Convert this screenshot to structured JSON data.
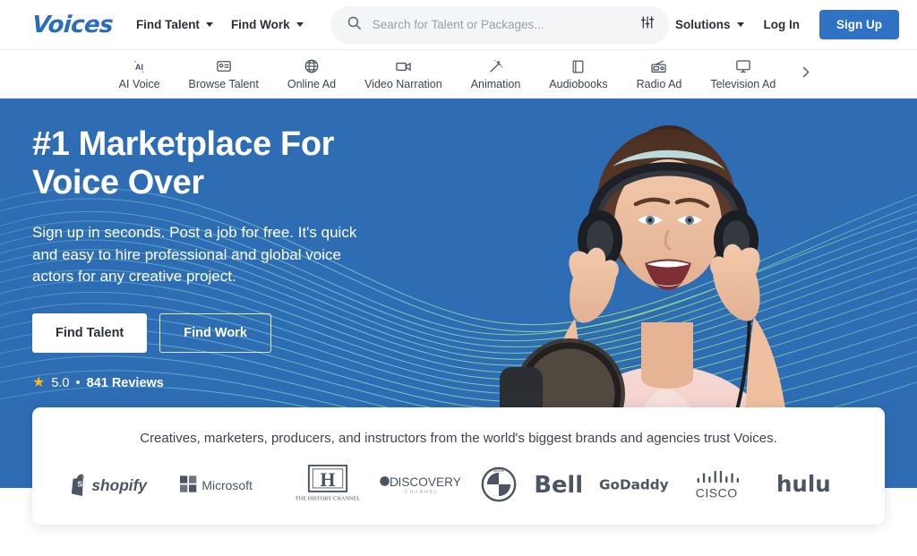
{
  "header": {
    "logo": "Voices",
    "nav": [
      {
        "label": "Find Talent",
        "icon": "chevron-down-icon"
      },
      {
        "label": "Find Work",
        "icon": "chevron-down-icon"
      }
    ],
    "search": {
      "placeholder": "Search for Talent or Packages...",
      "value": "",
      "search_icon": "search-icon",
      "filter_icon": "sliders-filter-icon"
    },
    "solutions": "Solutions",
    "login": "Log In",
    "signup": "Sign Up",
    "accent_color": "#2f72c4"
  },
  "categories": {
    "items": [
      {
        "label": "AI Voice",
        "icon": "ai-icon"
      },
      {
        "label": "Browse Talent",
        "icon": "id-card-icon"
      },
      {
        "label": "Online Ad",
        "icon": "globe-icon"
      },
      {
        "label": "Video Narration",
        "icon": "video-camera-icon"
      },
      {
        "label": "Animation",
        "icon": "magic-wand-icon"
      },
      {
        "label": "Audiobooks",
        "icon": "book-icon"
      },
      {
        "label": "Radio Ad",
        "icon": "radio-icon"
      },
      {
        "label": "Television Ad",
        "icon": "monitor-icon"
      }
    ],
    "next_icon": "chevron-right-icon"
  },
  "hero": {
    "headline_line1": "#1 Marketplace For",
    "headline_line2": "Voice Over",
    "subtext": "Sign up in seconds. Post a job for free. It's quick and easy to hire professional and global voice actors for any creative project.",
    "cta_primary": "Find Talent",
    "cta_secondary": "Find Work",
    "rating_score": "5.0",
    "rating_separator": "•",
    "rating_reviews": "841 Reviews",
    "star_icon": "star-icon",
    "background_color": "#2e6db4",
    "star_color": "#f5b722",
    "photo_alt": "woman-with-headphones-at-microphone"
  },
  "trust": {
    "title": "Creatives, marketers, producers, and instructors from the world's biggest brands and agencies trust Voices.",
    "logos": [
      {
        "name": "Shopify",
        "icon": "shopify-logo"
      },
      {
        "name": "Microsoft",
        "icon": "microsoft-logo"
      },
      {
        "name": "The History Channel",
        "icon": "history-channel-logo"
      },
      {
        "name": "Discovery Channel",
        "icon": "discovery-logo"
      },
      {
        "name": "BMW",
        "icon": "bmw-logo"
      },
      {
        "name": "Bell",
        "icon": "bell-logo"
      },
      {
        "name": "GoDaddy",
        "icon": "godaddy-logo"
      },
      {
        "name": "Cisco",
        "icon": "cisco-logo"
      },
      {
        "name": "hulu",
        "icon": "hulu-logo"
      }
    ]
  }
}
